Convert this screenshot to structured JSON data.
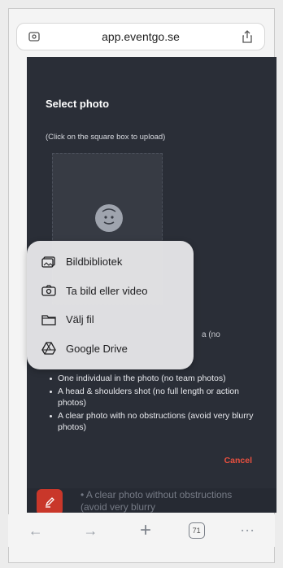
{
  "browser": {
    "url": "app.eventgo.se",
    "toolbar_tab_count": "71"
  },
  "modal": {
    "title": "Select photo",
    "subtitle": "(Click on the square box to upload)",
    "partial_text_right": "a (no",
    "rules": [
      "One individual in the photo (no team photos)",
      "A head & shoulders shot (no full length or action photos)",
      "A clear photo with no obstructions (avoid very blurry photos)"
    ],
    "cancel_label": "Cancel"
  },
  "background": {
    "partial_rule_text": "• A clear photo without obstructions (avoid very blurry"
  },
  "action_sheet": {
    "items": [
      {
        "label": "Bildbibliotek",
        "icon": "photo-library-icon"
      },
      {
        "label": "Ta bild eller video",
        "icon": "camera-icon"
      },
      {
        "label": "Välj fil",
        "icon": "folder-icon"
      },
      {
        "label": "Google Drive",
        "icon": "google-drive-icon"
      }
    ]
  },
  "colors": {
    "page_bg": "#262a33",
    "accent_red": "#e8503f",
    "fab_red": "#c9372a"
  }
}
